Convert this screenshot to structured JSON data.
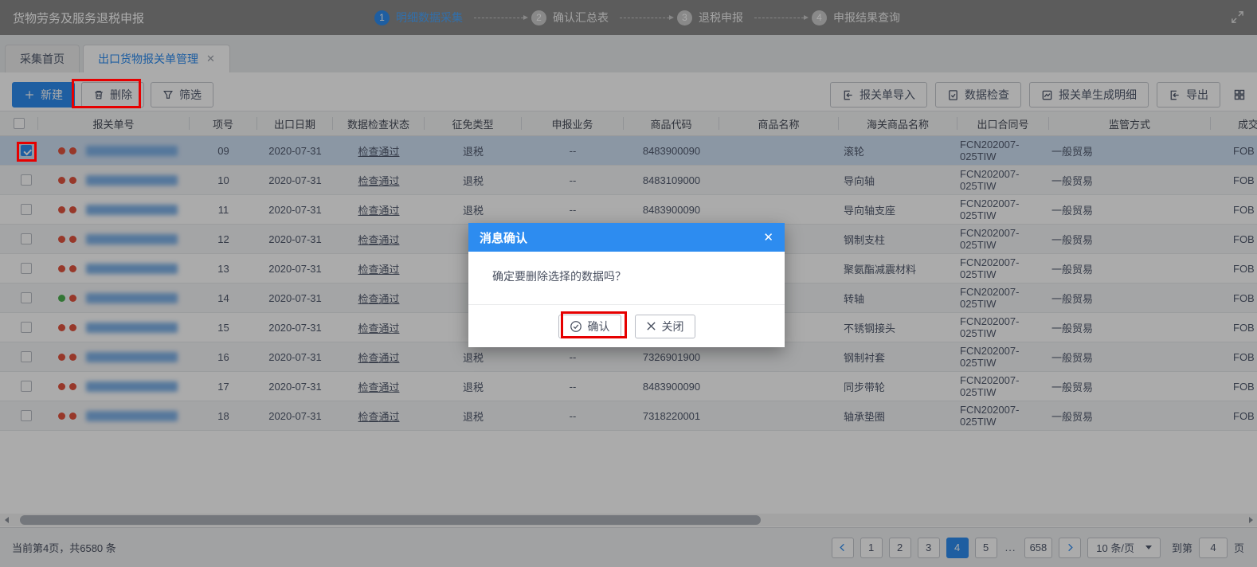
{
  "topbar": {
    "title": "货物劳务及服务退税申报",
    "steps": [
      {
        "num": "1",
        "label": "明细数据采集",
        "active": true
      },
      {
        "num": "2",
        "label": "确认汇总表",
        "active": false
      },
      {
        "num": "3",
        "label": "退税申报",
        "active": false
      },
      {
        "num": "4",
        "label": "申报结果查询",
        "active": false
      }
    ]
  },
  "tabs": [
    {
      "label": "采集首页",
      "active": false,
      "closable": false
    },
    {
      "label": "出口货物报关单管理",
      "active": true,
      "closable": true
    }
  ],
  "toolbar": {
    "left": [
      {
        "label": "新建",
        "icon": "plus-icon",
        "style": "primary"
      },
      {
        "label": "删除",
        "icon": "trash-icon",
        "style": "default"
      },
      {
        "label": "筛选",
        "icon": "filter-icon",
        "style": "default"
      }
    ],
    "right": [
      {
        "label": "报关单导入",
        "icon": "import-icon"
      },
      {
        "label": "数据检查",
        "icon": "doc-check-icon"
      },
      {
        "label": "报关单生成明细",
        "icon": "chart-icon"
      },
      {
        "label": "导出",
        "icon": "export-icon"
      }
    ]
  },
  "table": {
    "columns": [
      "",
      "报关单号",
      "项号",
      "出口日期",
      "数据检查状态",
      "征免类型",
      "申报业务",
      "商品代码",
      "商品名称",
      "海关商品名称",
      "出口合同号",
      "监管方式",
      "成交方式"
    ],
    "rows": [
      {
        "selected": true,
        "dots": [
          "red",
          "red"
        ],
        "item_no": "09",
        "export_date": "2020-07-31",
        "check_status": "检查通过",
        "tax_type": "退税",
        "declare_biz": "--",
        "commodity_code": "8483900090",
        "commodity_name": "",
        "customs_name": "滚轮",
        "contract_no": "FCN202007-025TIW",
        "supervision": "一般贸易",
        "deal": "FOB"
      },
      {
        "selected": false,
        "dots": [
          "red",
          "red"
        ],
        "item_no": "10",
        "export_date": "2020-07-31",
        "check_status": "检查通过",
        "tax_type": "退税",
        "declare_biz": "--",
        "commodity_code": "8483109000",
        "commodity_name": "",
        "customs_name": "导向轴",
        "contract_no": "FCN202007-025TIW",
        "supervision": "一般贸易",
        "deal": "FOB"
      },
      {
        "selected": false,
        "dots": [
          "red",
          "red"
        ],
        "item_no": "11",
        "export_date": "2020-07-31",
        "check_status": "检查通过",
        "tax_type": "退税",
        "declare_biz": "--",
        "commodity_code": "8483900090",
        "commodity_name": "",
        "customs_name": "导向轴支座",
        "contract_no": "FCN202007-025TIW",
        "supervision": "一般贸易",
        "deal": "FOB"
      },
      {
        "selected": false,
        "dots": [
          "red",
          "red"
        ],
        "item_no": "12",
        "export_date": "2020-07-31",
        "check_status": "检查通过",
        "tax_type": "",
        "declare_biz": "",
        "commodity_code": "",
        "commodity_name": "",
        "customs_name": "钢制支柱",
        "contract_no": "FCN202007-025TIW",
        "supervision": "一般贸易",
        "deal": "FOB"
      },
      {
        "selected": false,
        "dots": [
          "red",
          "red"
        ],
        "item_no": "13",
        "export_date": "2020-07-31",
        "check_status": "检查通过",
        "tax_type": "",
        "declare_biz": "",
        "commodity_code": "",
        "commodity_name": "",
        "customs_name": "聚氨酯减震材料",
        "contract_no": "FCN202007-025TIW",
        "supervision": "一般贸易",
        "deal": "FOB"
      },
      {
        "selected": false,
        "dots": [
          "green",
          "red"
        ],
        "item_no": "14",
        "export_date": "2020-07-31",
        "check_status": "检查通过",
        "tax_type": "",
        "declare_biz": "",
        "commodity_code": "",
        "commodity_name": "",
        "customs_name": "转轴",
        "contract_no": "FCN202007-025TIW",
        "supervision": "一般贸易",
        "deal": "FOB"
      },
      {
        "selected": false,
        "dots": [
          "red",
          "red"
        ],
        "item_no": "15",
        "export_date": "2020-07-31",
        "check_status": "检查通过",
        "tax_type": "",
        "declare_biz": "",
        "commodity_code": "",
        "commodity_name": "",
        "customs_name": "不锈钢接头",
        "contract_no": "FCN202007-025TIW",
        "supervision": "一般贸易",
        "deal": "FOB"
      },
      {
        "selected": false,
        "dots": [
          "red",
          "red"
        ],
        "item_no": "16",
        "export_date": "2020-07-31",
        "check_status": "检查通过",
        "tax_type": "退税",
        "declare_biz": "--",
        "commodity_code": "7326901900",
        "commodity_name": "",
        "customs_name": "钢制衬套",
        "contract_no": "FCN202007-025TIW",
        "supervision": "一般贸易",
        "deal": "FOB"
      },
      {
        "selected": false,
        "dots": [
          "red",
          "red"
        ],
        "item_no": "17",
        "export_date": "2020-07-31",
        "check_status": "检查通过",
        "tax_type": "退税",
        "declare_biz": "--",
        "commodity_code": "8483900090",
        "commodity_name": "",
        "customs_name": "同步带轮",
        "contract_no": "FCN202007-025TIW",
        "supervision": "一般贸易",
        "deal": "FOB"
      },
      {
        "selected": false,
        "dots": [
          "red",
          "red"
        ],
        "item_no": "18",
        "export_date": "2020-07-31",
        "check_status": "检查通过",
        "tax_type": "退税",
        "declare_biz": "--",
        "commodity_code": "7318220001",
        "commodity_name": "",
        "customs_name": "轴承垫圈",
        "contract_no": "FCN202007-025TIW",
        "supervision": "一般贸易",
        "deal": "FOB"
      }
    ]
  },
  "statusbar": {
    "text": "当前第4页，共6580 条"
  },
  "pagination": {
    "pages": [
      "1",
      "2",
      "3",
      "4",
      "5"
    ],
    "active": "4",
    "ellipsis": "...",
    "last_page": "658",
    "page_size": "10 条/页",
    "goto_label": "到第",
    "goto_value": "4",
    "goto_unit": "页"
  },
  "modal": {
    "title": "消息确认",
    "message": "确定要删除选择的数据吗？",
    "confirm_label": "确认",
    "close_label": "关闭"
  },
  "colors": {
    "accent": "#2d8cf0",
    "modal_header": "#2d8cf0",
    "annotation_red": "#e60000",
    "dot_red": "#e2543f",
    "dot_green": "#4cb050",
    "selected_row": "#d0e1f5"
  }
}
